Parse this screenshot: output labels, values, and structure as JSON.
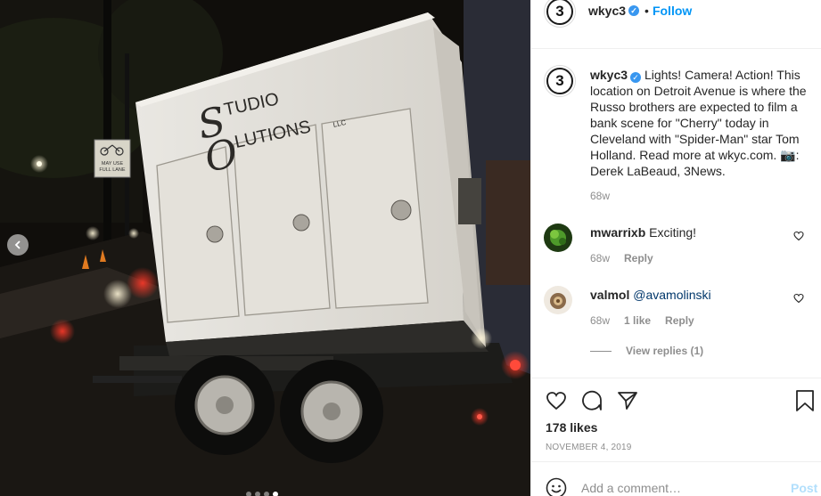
{
  "post": {
    "photo": {
      "sign_text": [
        "MAY USE",
        "FULL LANE"
      ],
      "generator_brand": {
        "line1_cap": "S",
        "line1": "TUDIO",
        "line2_cap": "O",
        "line2": "LUTIONS",
        "suffix": "LLC"
      },
      "carousel_dots": 4,
      "carousel_active_index": 3
    },
    "author": {
      "username": "wkyc3",
      "avatar_text": "3",
      "verified": true,
      "separator": "•",
      "follow_label": "Follow"
    },
    "more_label": "•••",
    "caption": {
      "username": "wkyc3",
      "text": "Lights! Camera! Action! This location on Detroit Avenue is where the Russo brothers are expected to film a bank scene for \"Cherry\" today in Cleveland with \"Spider-Man\" star Tom Holland. Read more at wkyc.com. 📷: Derek LaBeaud, 3News.",
      "age": "68w"
    },
    "comments": [
      {
        "username": "mwarrixb",
        "text": "Exciting!",
        "age": "68w",
        "likes": "",
        "reply_label": "Reply"
      },
      {
        "username": "valmol",
        "text": "@avamolinski",
        "age": "68w",
        "likes": "1 like",
        "reply_label": "Reply"
      }
    ],
    "view_replies_label": "View replies (1)",
    "likes_label": "178 likes",
    "date_label": "NOVEMBER 4, 2019",
    "add_comment_placeholder": "Add a comment…",
    "post_label": "Post"
  },
  "colors": {
    "link_blue": "#0095f6",
    "post_disabled": "#b2dffc",
    "muted_text": "#8e8e8e",
    "verified_blue": "#3897f0"
  },
  "icons": [
    "chevron-left-icon",
    "more-icon",
    "verified-icon",
    "heart-icon",
    "comment-icon",
    "share-icon",
    "bookmark-icon",
    "emoji-icon"
  ]
}
